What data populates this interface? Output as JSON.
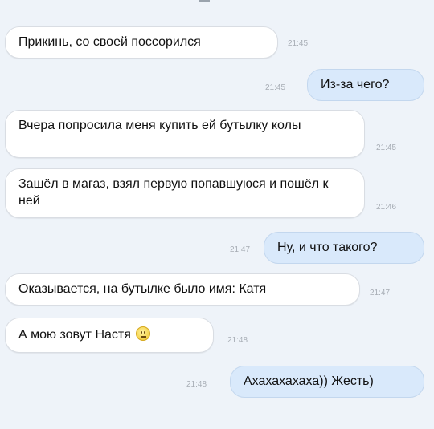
{
  "chat": {
    "messages": [
      {
        "direction": "incoming",
        "text": "Прикинь, со своей поссорился",
        "time": "21:45"
      },
      {
        "direction": "outgoing",
        "text": "Из-за чего?",
        "time": "21:45"
      },
      {
        "direction": "incoming",
        "text": "Вчера попросила меня купить ей бутылку колы",
        "time": "21:45"
      },
      {
        "direction": "incoming",
        "text": "Зашёл в магаз, взял первую попавшуюся и пошёл к ней",
        "time": "21:46"
      },
      {
        "direction": "outgoing",
        "text": "Ну, и что такого?",
        "time": "21:47"
      },
      {
        "direction": "incoming",
        "text": "Оказывается, на бутылке было имя: Катя",
        "time": "21:47"
      },
      {
        "direction": "incoming",
        "text": "А мою зовут Настя",
        "time": "21:48",
        "emoji": "neutral-face-icon"
      },
      {
        "direction": "outgoing",
        "text": "Ахахахахаха)) Жесть)",
        "time": "21:48"
      }
    ]
  }
}
